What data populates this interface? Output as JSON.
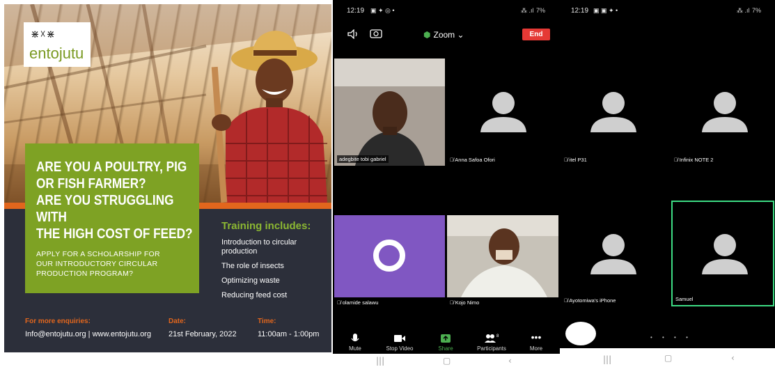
{
  "poster": {
    "logo_text": "entojutu",
    "headline_lines": [
      "ARE YOU A POULTRY, PIG",
      "OR FISH FARMER?",
      "ARE YOU STRUGGLING WITH",
      "THE HIGH COST OF FEED?"
    ],
    "sub_lines": [
      "APPLY FOR A SCHOLARSHIP FOR",
      "OUR INTRODUCTORY CIRCULAR",
      "PRODUCTION PROGRAM?"
    ],
    "training_title": "Training includes:",
    "training_items": [
      "Introduction to circular production",
      "The role of insects",
      "Optimizing waste",
      "Reducing feed cost"
    ],
    "enquiries_label": "For more enquiries:",
    "enquiries_value": "Info@entojutu.org  |  www.entojutu.org",
    "date_label": "Date:",
    "date_value": "21st February, 2022",
    "time_label": "Time:",
    "time_value": "11:00am - 1:00pm",
    "colors": {
      "green": "#7ea224",
      "orange": "#e2661d",
      "dark": "#2c2f3a"
    }
  },
  "phone1": {
    "status_time": "12:19",
    "status_right": "7%",
    "app_title": "Zoom",
    "end_label": "End",
    "participants": [
      {
        "name": "adegbite tobi gabriel"
      },
      {
        "name": "Anna Safoa Ofori"
      },
      {
        "name": "olamide salawu",
        "initial": "O"
      },
      {
        "name": "Kojo Nimo"
      }
    ],
    "toolbar": [
      {
        "label": "Mute",
        "icon": "mic-icon"
      },
      {
        "label": "Stop Video",
        "icon": "video-icon"
      },
      {
        "label": "Share",
        "icon": "share-icon"
      },
      {
        "label": "Participants",
        "icon": "participants-icon",
        "badge": "8"
      },
      {
        "label": "More",
        "icon": "more-icon"
      }
    ],
    "accent": "#4caf50"
  },
  "phone2": {
    "status_time": "12:19",
    "status_right": "7%",
    "participants": [
      {
        "name": "itel P31"
      },
      {
        "name": "Infinix NOTE 2"
      },
      {
        "name": "Ayotomiwa's iPhone"
      },
      {
        "name": "Samuel"
      }
    ],
    "active_color": "#3ddc84"
  }
}
